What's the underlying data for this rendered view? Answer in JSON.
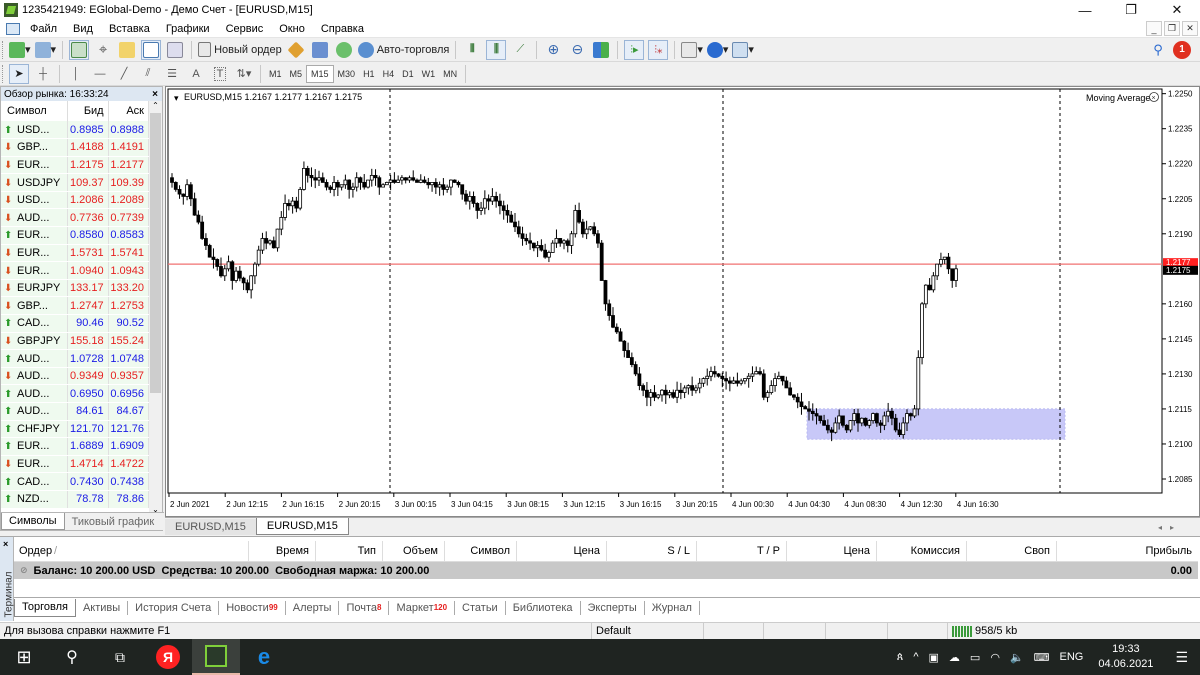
{
  "window": {
    "title": "1235421949: EGlobal-Demo - Демо Счет - [EURUSD,M15]",
    "controls": {
      "minimize": "—",
      "restore": "❐",
      "close": "✕"
    }
  },
  "menu": {
    "items": [
      "Файл",
      "Вид",
      "Вставка",
      "Графики",
      "Сервис",
      "Окно",
      "Справка"
    ],
    "mdi_controls": {
      "minimize": "_",
      "restore": "❐",
      "close": "✕"
    }
  },
  "toolbar1": {
    "new_order": "Новый ордер",
    "auto_trading": "Авто-торговля",
    "notification_count": "1"
  },
  "toolbar2": {
    "timeframes": [
      "M1",
      "M5",
      "M15",
      "M30",
      "H1",
      "H4",
      "D1",
      "W1",
      "MN"
    ],
    "active_timeframe": "M15",
    "tools": {
      "text": "A",
      "text_label": "T"
    }
  },
  "market_watch": {
    "title": "Обзор рынка: 16:33:24",
    "close": "×",
    "columns": [
      "Символ",
      "Бид",
      "Аск"
    ],
    "rows": [
      {
        "symbol": "USD...",
        "bid": "0.8985",
        "ask": "0.8988",
        "dir": "up"
      },
      {
        "symbol": "GBP...",
        "bid": "1.4188",
        "ask": "1.4191",
        "dir": "down"
      },
      {
        "symbol": "EUR...",
        "bid": "1.2175",
        "ask": "1.2177",
        "dir": "down"
      },
      {
        "symbol": "USDJPY",
        "bid": "109.37",
        "ask": "109.39",
        "dir": "down"
      },
      {
        "symbol": "USD...",
        "bid": "1.2086",
        "ask": "1.2089",
        "dir": "down"
      },
      {
        "symbol": "AUD...",
        "bid": "0.7736",
        "ask": "0.7739",
        "dir": "down"
      },
      {
        "symbol": "EUR...",
        "bid": "0.8580",
        "ask": "0.8583",
        "dir": "up"
      },
      {
        "symbol": "EUR...",
        "bid": "1.5731",
        "ask": "1.5741",
        "dir": "down"
      },
      {
        "symbol": "EUR...",
        "bid": "1.0940",
        "ask": "1.0943",
        "dir": "down"
      },
      {
        "symbol": "EURJPY",
        "bid": "133.17",
        "ask": "133.20",
        "dir": "down"
      },
      {
        "symbol": "GBP...",
        "bid": "1.2747",
        "ask": "1.2753",
        "dir": "down"
      },
      {
        "symbol": "CAD...",
        "bid": "90.46",
        "ask": "90.52",
        "dir": "up"
      },
      {
        "symbol": "GBPJPY",
        "bid": "155.18",
        "ask": "155.24",
        "dir": "down"
      },
      {
        "symbol": "AUD...",
        "bid": "1.0728",
        "ask": "1.0748",
        "dir": "up"
      },
      {
        "symbol": "AUD...",
        "bid": "0.9349",
        "ask": "0.9357",
        "dir": "down"
      },
      {
        "symbol": "AUD...",
        "bid": "0.6950",
        "ask": "0.6956",
        "dir": "up"
      },
      {
        "symbol": "AUD...",
        "bid": "84.61",
        "ask": "84.67",
        "dir": "up"
      },
      {
        "symbol": "CHFJPY",
        "bid": "121.70",
        "ask": "121.76",
        "dir": "up"
      },
      {
        "symbol": "EUR...",
        "bid": "1.6889",
        "ask": "1.6909",
        "dir": "up"
      },
      {
        "symbol": "EUR...",
        "bid": "1.4714",
        "ask": "1.4722",
        "dir": "down"
      },
      {
        "symbol": "CAD...",
        "bid": "0.7430",
        "ask": "0.7438",
        "dir": "up"
      },
      {
        "symbol": "NZD...",
        "bid": "78.78",
        "ask": "78.86",
        "dir": "up"
      }
    ],
    "tabs": [
      "Символы",
      "Тиковый график"
    ],
    "colors": {
      "up": "#1a1ae6",
      "down": "#e62020"
    }
  },
  "chart": {
    "header": "EURUSD,M15  1.2167 1.2177 1.2167 1.2175",
    "indicator": "Moving Average",
    "tabs": [
      "EURUSD,M15",
      "EURUSD,M15"
    ],
    "active_tab": 1,
    "ask_label": "1.2177",
    "bid_label": "1.2175"
  },
  "chart_data": {
    "type": "candlestick",
    "symbol": "EURUSD",
    "timeframe": "M15",
    "ylim": [
      1.2079,
      1.2252
    ],
    "yticks": [
      "1.2250",
      "1.2235",
      "1.2220",
      "1.2205",
      "1.2190",
      "1.2175",
      "1.2160",
      "1.2145",
      "1.2130",
      "1.2115",
      "1.2100",
      "1.2085"
    ],
    "xticks": [
      "2 Jun 2021",
      "2 Jun 12:15",
      "2 Jun 16:15",
      "2 Jun 20:15",
      "3 Jun 00:15",
      "3 Jun 04:15",
      "3 Jun 08:15",
      "3 Jun 12:15",
      "3 Jun 16:15",
      "3 Jun 20:15",
      "4 Jun 00:30",
      "4 Jun 04:30",
      "4 Jun 08:30",
      "4 Jun 12:30",
      "4 Jun 16:30"
    ],
    "period_separators": [
      "3 Jun 00:15",
      "4 Jun 00:30"
    ],
    "bid_line": 1.2177,
    "bid_line_color": "#f07070",
    "rectangle": {
      "price_top": 1.2115,
      "price_bottom": 1.2102,
      "from": "4 Jun 04:30",
      "to": "4 Jun 16:30+",
      "color": "#c8c8f8"
    },
    "close_path": [
      1.2212,
      1.2209,
      1.2207,
      1.2206,
      1.2211,
      1.2205,
      1.2198,
      1.2195,
      1.2188,
      1.2185,
      1.218,
      1.2179,
      1.2176,
      1.2172,
      1.2175,
      1.2178,
      1.217,
      1.2174,
      1.2171,
      1.2169,
      1.2166,
      1.2172,
      1.2177,
      1.2183,
      1.2188,
      1.2186,
      1.2187,
      1.2184,
      1.2192,
      1.2197,
      1.2203,
      1.2202,
      1.2204,
      1.2201,
      1.2209,
      1.2218,
      1.2215,
      1.2214,
      1.2213,
      1.2214,
      1.2212,
      1.221,
      1.2209,
      1.2212,
      1.221,
      1.2211,
      1.2213,
      1.2209,
      1.221,
      1.2214,
      1.2212,
      1.221,
      1.2213,
      1.2215,
      1.2214,
      1.221,
      1.2211,
      1.2212,
      1.2213,
      1.2212,
      1.2213,
      1.2214,
      1.2213,
      1.2214,
      1.2213,
      1.2212,
      1.2213,
      1.2212,
      1.2211,
      1.2212,
      1.221,
      1.2211,
      1.2209,
      1.221,
      1.2213,
      1.2212,
      1.2211,
      1.2207,
      1.2204,
      1.2206,
      1.2203,
      1.22,
      1.2201,
      1.2205,
      1.2204,
      1.2206,
      1.2204,
      1.2202,
      1.22,
      1.2198,
      1.2195,
      1.2193,
      1.219,
      1.2188,
      1.2187,
      1.2186,
      1.2184,
      1.2185,
      1.2183,
      1.218,
      1.2182,
      1.2186,
      1.2188,
      1.2186,
      1.2187,
      1.2185,
      1.219,
      1.22,
      1.2195,
      1.219,
      1.2192,
      1.2193,
      1.219,
      1.2186,
      1.217,
      1.216,
      1.2155,
      1.215,
      1.2148,
      1.2144,
      1.214,
      1.2137,
      1.2134,
      1.213,
      1.2125,
      1.2123,
      1.212,
      1.2122,
      1.212,
      1.2121,
      1.2123,
      1.2121,
      1.2122,
      1.212,
      1.2123,
      1.2122,
      1.2124,
      1.2125,
      1.2123,
      1.2124,
      1.2126,
      1.2128,
      1.2129,
      1.2131,
      1.213,
      1.2129,
      1.2128,
      1.2127,
      1.2126,
      1.2127,
      1.2126,
      1.2127,
      1.2128,
      1.2129,
      1.213,
      1.2131,
      1.213,
      1.212,
      1.2122,
      1.2125,
      1.2128,
      1.2129,
      1.2127,
      1.2124,
      1.2121,
      1.212,
      1.2118,
      1.2116,
      1.2115,
      1.2114,
      1.2113,
      1.2112,
      1.211,
      1.2108,
      1.2106,
      1.2105,
      1.2109,
      1.2112,
      1.2108,
      1.2106,
      1.211,
      1.2113,
      1.2109,
      1.2111,
      1.2108,
      1.211,
      1.2113,
      1.2109,
      1.2108,
      1.2112,
      1.2114,
      1.2111,
      1.2106,
      1.2104,
      1.2109,
      1.2113,
      1.2112,
      1.2115,
      1.2137,
      1.216,
      1.2168,
      1.2166,
      1.2172,
      1.2177,
      1.2179,
      1.218,
      1.2175,
      1.217,
      1.2175
    ]
  },
  "terminal": {
    "side_label": "Терминал",
    "close": "×",
    "columns": [
      "Ордер",
      "/",
      "Время",
      "Тип",
      "Объем",
      "Символ",
      "Цена",
      "S / L",
      "T / P",
      "Цена",
      "Комиссия",
      "Своп",
      "Прибыль"
    ],
    "balance_line": "Баланс: 10 200.00 USD  Средства: 10 200.00  Свободная маржа: 10 200.00",
    "profit": "0.00",
    "tabs": [
      {
        "label": "Торговля",
        "badge": ""
      },
      {
        "label": "Активы",
        "badge": ""
      },
      {
        "label": "История Счета",
        "badge": ""
      },
      {
        "label": "Новости",
        "badge": "99"
      },
      {
        "label": "Алерты",
        "badge": ""
      },
      {
        "label": "Почта",
        "badge": "8"
      },
      {
        "label": "Маркет",
        "badge": "120"
      },
      {
        "label": "Статьи",
        "badge": ""
      },
      {
        "label": "Библиотека",
        "badge": ""
      },
      {
        "label": "Эксперты",
        "badge": ""
      },
      {
        "label": "Журнал",
        "badge": ""
      }
    ]
  },
  "statusbar": {
    "help": "Для вызова справки нажмите F1",
    "profile": "Default",
    "connection": "958/5 kb"
  },
  "taskbar": {
    "tray_lang": "ENG",
    "time": "19:33",
    "date": "04.06.2021"
  }
}
